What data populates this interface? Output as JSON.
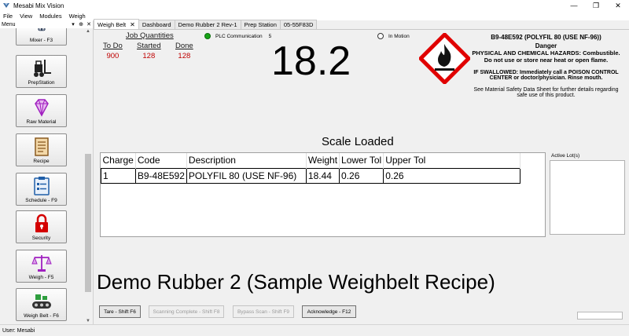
{
  "window": {
    "title": "Mesabi Mix Vision",
    "controls": [
      "—",
      "❐",
      "✕"
    ]
  },
  "menubar": [
    "File",
    "View",
    "Modules",
    "Weigh"
  ],
  "left_panel": {
    "title": "Menu",
    "controls": [
      "▾",
      "⊕",
      "✕"
    ],
    "buttons": [
      {
        "label": "Mixer - F3",
        "icon": "mixer-icon"
      },
      {
        "label": "PrepStation",
        "icon": "forklift-icon"
      },
      {
        "label": "Raw Material",
        "icon": "diamond-icon"
      },
      {
        "label": "Recipe",
        "icon": "document-icon"
      },
      {
        "label": "Schedule - F9",
        "icon": "clipboard-list-icon"
      },
      {
        "label": "Security",
        "icon": "padlock-icon"
      },
      {
        "label": "Weigh - F5",
        "icon": "balance-scale-icon"
      },
      {
        "label": "Weigh Belt - F6",
        "icon": "conveyor-belt-icon"
      }
    ]
  },
  "tabs": [
    {
      "label": "Weigh Belt",
      "active": true,
      "closable": true
    },
    {
      "label": "Dashboard"
    },
    {
      "label": "Demo Rubber 2 Rev-1"
    },
    {
      "label": "Prep Station"
    },
    {
      "label": "05-55F83D"
    }
  ],
  "job_quantities": {
    "title": "Job Quantities",
    "columns": [
      {
        "label": "To Do",
        "value": "900"
      },
      {
        "label": "Started",
        "value": "128"
      },
      {
        "label": "Done",
        "value": "128"
      }
    ]
  },
  "plc": {
    "label": "PLC Communication",
    "count": "5",
    "status_color": "#17a317"
  },
  "motion": {
    "label": "In Motion"
  },
  "weight_display": "18.2",
  "msds": {
    "material": "B9-48E592 (POLYFIL 80  (USE NF-96))",
    "signal_word": "Danger",
    "hazards_line1": "PHYSICAL AND CHEMICAL HAZARDS: Combustible.",
    "hazards_line2": "Do not use or store near heat or open flame.",
    "swallowed_line1": "IF SWALLOWED: Immediately call a POISON CONTROL",
    "swallowed_line2": "CENTER or doctor/physician. Rinse mouth.",
    "note_line1": "See Material Safety Data Sheet for further details regarding",
    "note_line2": "safe use of this product.",
    "pictogram": "flame-hazard-icon",
    "pictogram_color": "#e00000"
  },
  "scale_status": "Scale Loaded",
  "grid": {
    "columns": [
      "Charge",
      "Code",
      "Description",
      "Weight",
      "Lower Tol",
      "Upper Tol"
    ],
    "rows": [
      [
        "1",
        "B9-48E592",
        "POLYFIL 80  (USE NF-96)",
        "18.44",
        "0.26",
        "0.26"
      ]
    ]
  },
  "active_lots_label": "Active Lot(s)",
  "recipe_name": "Demo Rubber 2 (Sample Weighbelt Recipe)",
  "footer_buttons": [
    {
      "label": "Tare - Shift F6",
      "enabled": true
    },
    {
      "label": "Scanning Complete - Shift F8",
      "enabled": false
    },
    {
      "label": "Bypass Scan - Shift F9",
      "enabled": false
    },
    {
      "label": "Acknowledge - F12",
      "enabled": true
    }
  ],
  "status_bar": "User: Mesabi",
  "colors": {
    "quantity_value": "#c00000",
    "accent_purple": "#a020c0",
    "security_red": "#d40000",
    "schedule_blue": "#1f5ea8"
  }
}
